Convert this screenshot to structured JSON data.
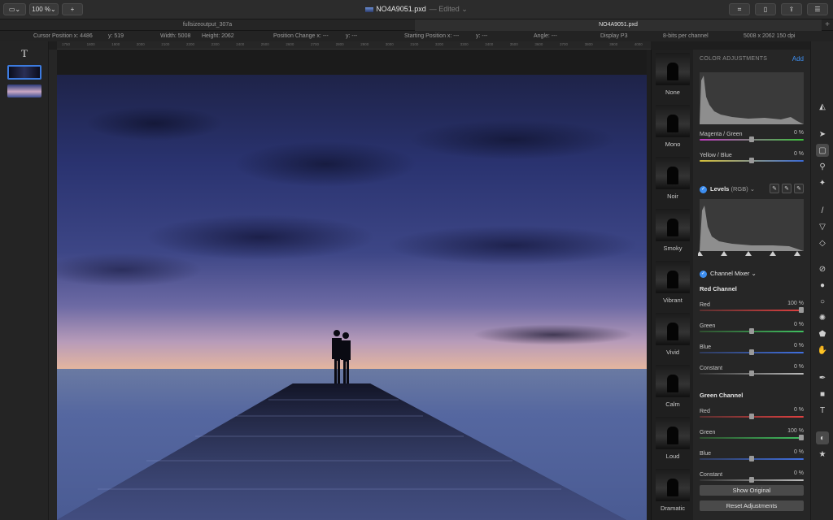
{
  "titlebar": {
    "zoom": "100 %",
    "filename": "NO4A9051.pxd",
    "status": "— Edited ⌄"
  },
  "tabs": [
    {
      "label": "fullsizeoutput_307a",
      "active": false
    },
    {
      "label": "NO4A9051.pxd",
      "active": true
    }
  ],
  "info": {
    "cursor_x": "Cursor Position x: 4486",
    "cursor_y": "y: 519",
    "width": "Width: 5008",
    "height": "Height: 2062",
    "pos_change_x": "Position Change x: ---",
    "pos_change_y": "y: ---",
    "start_x": "Starting Position x: ---",
    "start_y": "y: ---",
    "angle": "Angle: ---",
    "display": "Display P3",
    "bits": "8-bits per channel",
    "size": "5008 x 2062 150 dpi"
  },
  "ruler_ticks": [
    "1750",
    "1800",
    "1900",
    "2000",
    "2100",
    "2200",
    "2300",
    "2400",
    "2500",
    "2600",
    "2700",
    "2800",
    "2900",
    "3000",
    "3100",
    "3200",
    "3300",
    "3400",
    "3500",
    "3600",
    "3700",
    "3800",
    "3900",
    "4000"
  ],
  "layers": {
    "text_layer": "T"
  },
  "filters": [
    "None",
    "Mono",
    "Noir",
    "Smoky",
    "Vibrant",
    "Vivid",
    "Calm",
    "Loud",
    "Dramatic"
  ],
  "adjustments": {
    "header": "COLOR ADJUSTMENTS",
    "add": "Add",
    "magenta_green": {
      "label": "Magenta / Green",
      "value": "0 %",
      "level": 0.5
    },
    "yellow_blue": {
      "label": "Yellow / Blue",
      "value": "0 %",
      "level": 0.5
    },
    "levels": {
      "title": "Levels",
      "mode": "(RGB) ⌄"
    },
    "channel_mixer": {
      "title": "Channel Mixer ⌄"
    },
    "red_channel": {
      "title": "Red Channel",
      "rows": [
        {
          "label": "Red",
          "value": "100 %",
          "level": 1.0
        },
        {
          "label": "Green",
          "value": "0 %",
          "level": 0.5
        },
        {
          "label": "Blue",
          "value": "0 %",
          "level": 0.5
        },
        {
          "label": "Constant",
          "value": "0 %",
          "level": 0.5
        }
      ]
    },
    "green_channel": {
      "title": "Green Channel",
      "rows": [
        {
          "label": "Red",
          "value": "0 %",
          "level": 0.5
        },
        {
          "label": "Green",
          "value": "100 %",
          "level": 1.0
        },
        {
          "label": "Blue",
          "value": "0 %",
          "level": 0.5
        },
        {
          "label": "Constant",
          "value": "0 %",
          "level": 0.5
        }
      ]
    },
    "show_original": "Show Original",
    "reset": "Reset Adjustments"
  },
  "colors": {
    "accent": "#3d8ef0",
    "panel": "#262626"
  }
}
